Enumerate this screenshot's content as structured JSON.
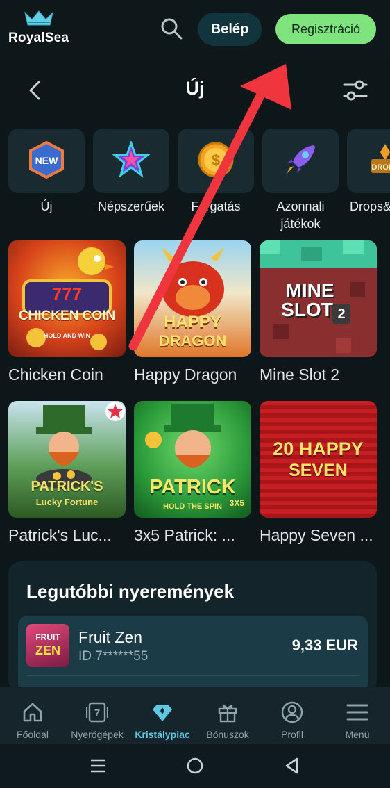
{
  "header": {
    "brand": "RoyalSea",
    "login_label": "Belép",
    "register_label": "Regisztráció"
  },
  "subheader": {
    "title": "Új"
  },
  "categories": [
    {
      "label": "Új",
      "icon": "new-badge-icon"
    },
    {
      "label": "Népszerűek",
      "icon": "star-icon"
    },
    {
      "label": "Forgatás",
      "icon": "coin-icon"
    },
    {
      "label": "Azonnali játékok",
      "icon": "rocket-icon"
    },
    {
      "label": "Drops&",
      "icon": "drops-wins-icon"
    }
  ],
  "games": [
    {
      "name": "Chicken Coin",
      "art_title": "CHICKEN COIN",
      "art_sub": "HOLD AND WIN",
      "art_top": "777"
    },
    {
      "name": "Happy Dragon",
      "art_title": "HAPPY",
      "art_sub": "DRAGON"
    },
    {
      "name": "Mine Slot 2",
      "art_title": "MINE",
      "art_sub": "SLOT",
      "art_num": "2"
    },
    {
      "name": "Patrick's Luc...",
      "art_title": "PATRICK'S",
      "art_sub": "Lucky Fortune"
    },
    {
      "name": "3x5 Patrick: ...",
      "art_title": "PATRICK",
      "art_sub": "HOLD THE SPIN",
      "art_badge": "3X5"
    },
    {
      "name": "Happy Seven ...",
      "art_title": "20 HAPPY",
      "art_sub": "SEVEN"
    }
  ],
  "recent_wins": {
    "title": "Legutóbbi nyeremények",
    "items": [
      {
        "game": "Fruit Zen",
        "id": "ID 7******55",
        "amount": "9,33 EUR",
        "thumb_top": "FRUIT",
        "thumb_bottom": "ZEN"
      }
    ]
  },
  "bottom_nav": [
    {
      "label": "Főoldal",
      "icon": "home-icon"
    },
    {
      "label": "Nyerőgépek",
      "icon": "slot-seven-icon"
    },
    {
      "label": "Kristálypiac",
      "icon": "diamond-icon",
      "active": true
    },
    {
      "label": "Bónuszok",
      "icon": "gift-icon"
    },
    {
      "label": "Profil",
      "icon": "profile-icon"
    },
    {
      "label": "Menü",
      "icon": "menu-icon"
    }
  ],
  "colors": {
    "background": "#0d1619",
    "register_green": "#7fe37e",
    "login_teal": "#12343c",
    "active_nav": "#5cc8e3",
    "annotation_arrow": "#f0353f"
  }
}
